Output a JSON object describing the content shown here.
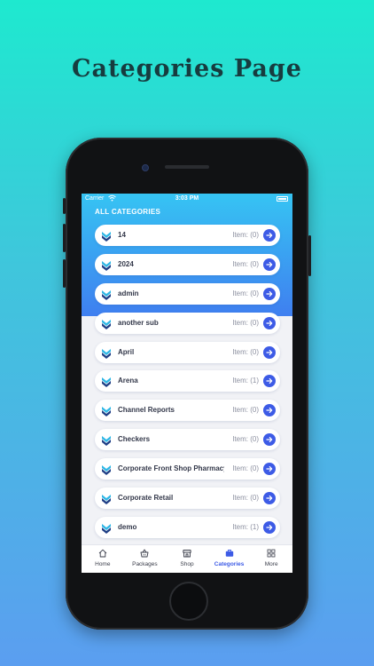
{
  "promo": {
    "title": "Categories Page"
  },
  "status_bar": {
    "carrier": "Carrier",
    "time": "3:03 PM"
  },
  "section_title": "ALL CATEGORIES",
  "item_count_prefix": "Item:",
  "categories": [
    {
      "name": "14",
      "count": "Item: (0)"
    },
    {
      "name": "2024",
      "count": "Item: (0)"
    },
    {
      "name": "admin",
      "count": "Item: (0)"
    },
    {
      "name": "another sub",
      "count": "Item: (0)"
    },
    {
      "name": "April",
      "count": "Item: (0)"
    },
    {
      "name": "Arena",
      "count": "Item: (1)"
    },
    {
      "name": "Channel Reports",
      "count": "Item: (0)"
    },
    {
      "name": "Checkers",
      "count": "Item: (0)"
    },
    {
      "name": "Corporate Front Shop Pharmacy",
      "count": "Item: (0)"
    },
    {
      "name": "Corporate Retail",
      "count": "Item: (0)"
    },
    {
      "name": "demo",
      "count": "Item: (1)"
    }
  ],
  "tabs": [
    {
      "label": "Home",
      "icon": "home-icon"
    },
    {
      "label": "Packages",
      "icon": "basket-icon"
    },
    {
      "label": "Shop",
      "icon": "store-icon"
    },
    {
      "label": "Categories",
      "icon": "briefcase-icon",
      "active": true
    },
    {
      "label": "More",
      "icon": "grid-icon"
    }
  ],
  "colors": {
    "accent": "#3d5be6",
    "header_top": "#36c4f3",
    "header_bottom": "#3f7ff0",
    "background_top": "#1ee9cf",
    "background_bottom": "#5b9ef0"
  }
}
